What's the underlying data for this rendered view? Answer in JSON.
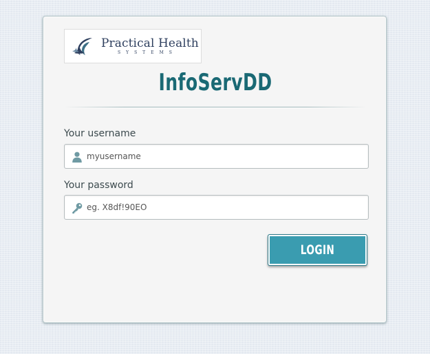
{
  "logo": {
    "name": "Practical Health",
    "subtitle": "SYSTEMS"
  },
  "app": {
    "title": "InfoServDD"
  },
  "form": {
    "username": {
      "label": "Your username",
      "placeholder": "myusername",
      "icon": "user-icon"
    },
    "password": {
      "label": "Your password",
      "placeholder": "eg. X8df!90EO",
      "icon": "key-icon"
    },
    "submit_label": "LOGIN"
  },
  "colors": {
    "accent": "#3a9cb0",
    "title": "#1a6974",
    "card": "#f5f5f5"
  }
}
